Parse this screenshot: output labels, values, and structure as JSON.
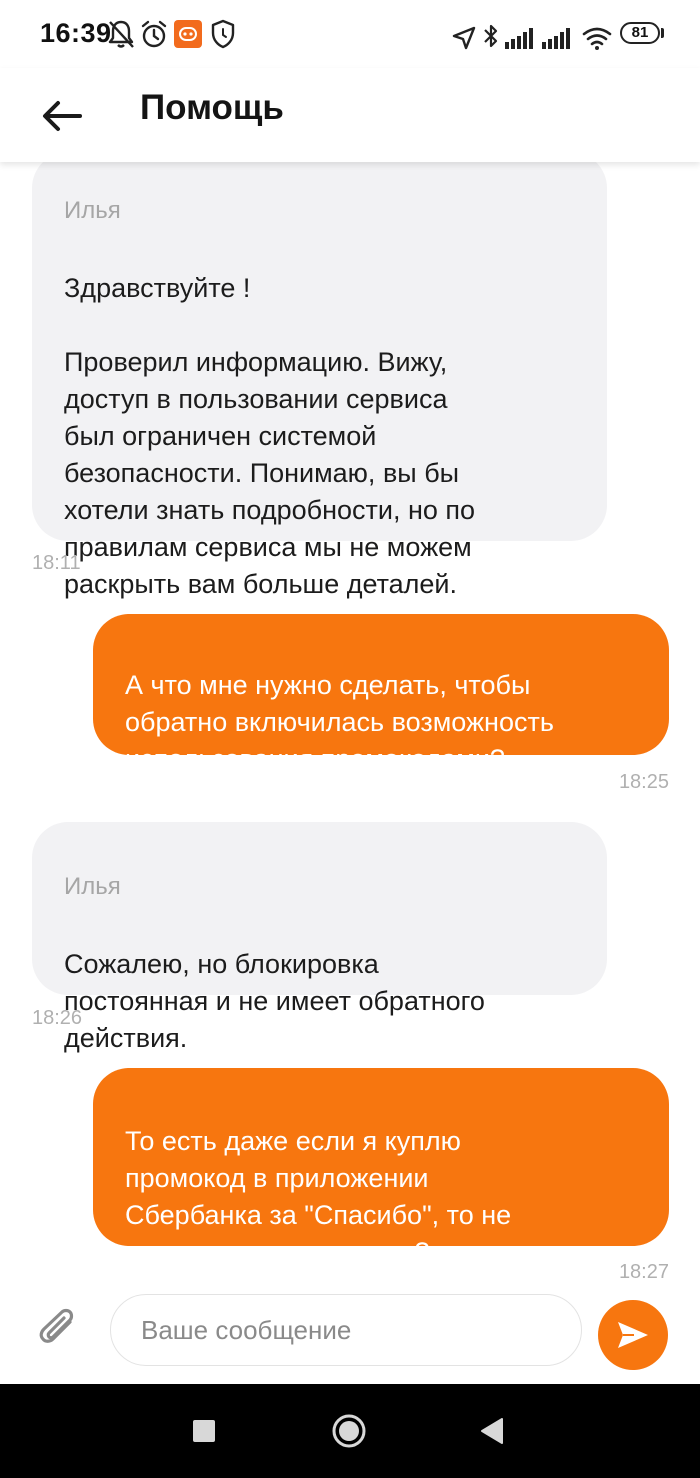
{
  "status_bar": {
    "time": "16:39",
    "battery": "81",
    "icons_left": [
      "bell-off-icon",
      "alarm-icon",
      "mi-app-icon",
      "shield-icon"
    ],
    "icons_right": [
      "location-arrow-icon",
      "bluetooth-icon",
      "signal-icon",
      "signal-icon",
      "wifi-icon",
      "battery-icon"
    ]
  },
  "header": {
    "title": "Помощь",
    "back_icon": "arrow-left-icon"
  },
  "messages": [
    {
      "direction": "incoming",
      "sender": "Илья",
      "text": "Здравствуйте !\n\nПроверил информацию. Вижу,\nдоступ в пользовании сервиса\nбыл ограничен системой\nбезопасности. Понимаю, вы бы\nхотели знать подробности, но по\nправилам сервиса мы не можем\nраскрыть вам больше деталей.",
      "time": "18:11"
    },
    {
      "direction": "outgoing",
      "text": "А что мне нужно сделать, чтобы\nобратно включилась возможность\nиспользования промокодами?",
      "time": "18:25"
    },
    {
      "direction": "incoming",
      "sender": "Илья",
      "text": "Сожалею, но блокировка\nпостоянная и не имеет обратного\nдействия.",
      "time": "18:26"
    },
    {
      "direction": "outgoing",
      "text": "То есть даже если я куплю\nпромокод в приложении\nСбербанка за \"Спасибо\", то не\nсмогу воспользоваться?",
      "time": "18:27"
    }
  ],
  "input_bar": {
    "placeholder": "Ваше сообщение",
    "attach_icon": "paperclip-icon",
    "send_icon": "send-icon"
  },
  "nav_bar": {
    "buttons": [
      "recent-apps-icon",
      "home-icon",
      "back-triangle-icon"
    ]
  },
  "colors": {
    "accent": "#f7760f",
    "incoming_bubble": "#f2f2f4",
    "timestamp": "#b0b0b0",
    "sender": "#a6a6a6"
  }
}
